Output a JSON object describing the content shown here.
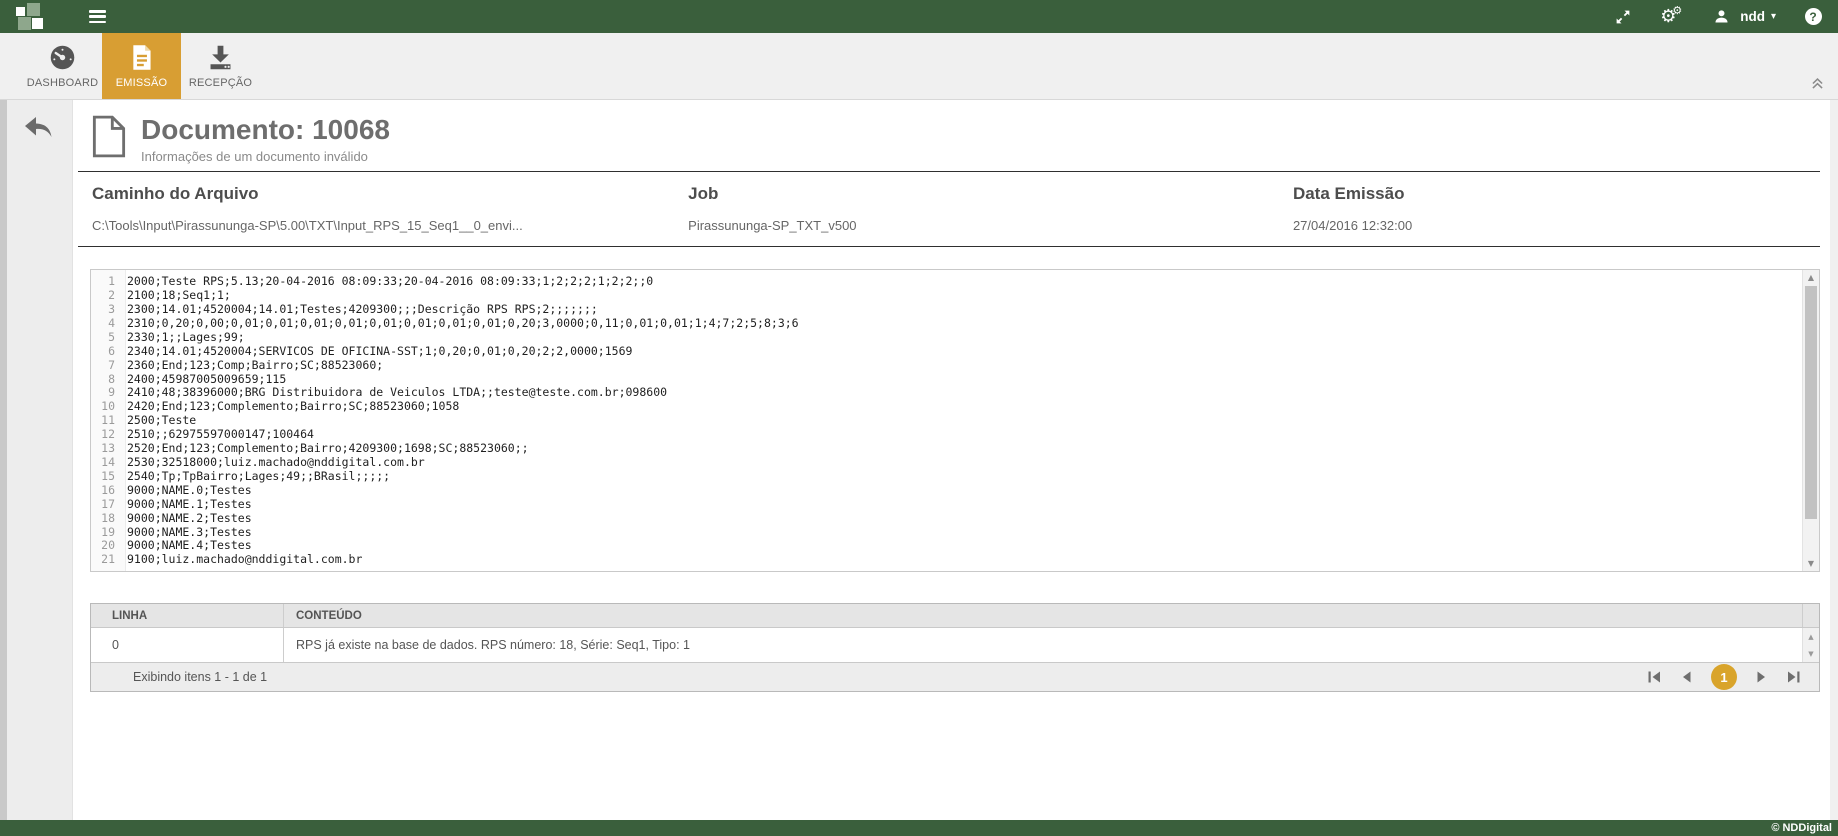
{
  "topbar": {
    "user_label": "ndd",
    "help_glyph": "?"
  },
  "nav": {
    "tabs": [
      {
        "label": "DASHBOARD",
        "active": false
      },
      {
        "label": "EMISSÃO",
        "active": true
      },
      {
        "label": "RECEPÇÃO",
        "active": false
      }
    ]
  },
  "document": {
    "title": "Documento: 10068",
    "subtitle": "Informações de um documento inválido",
    "fields": [
      {
        "label": "Caminho do Arquivo",
        "value": "C:\\Tools\\Input\\Pirassununga-SP\\5.00\\TXT\\Input_RPS_15_Seq1__0_envi..."
      },
      {
        "label": "Job",
        "value": "Pirassununga-SP_TXT_v500"
      },
      {
        "label": "Data Emissão",
        "value": "27/04/2016 12:32:00"
      }
    ]
  },
  "code": {
    "lines": [
      "2000;Teste RPS;5.13;20-04-2016 08:09:33;20-04-2016 08:09:33;1;2;2;2;1;2;2;;0",
      "2100;18;Seq1;1;",
      "2300;14.01;4520004;14.01;Testes;4209300;;;Descrição RPS RPS;2;;;;;;;",
      "2310;0,20;0,00;0,01;0,01;0,01;0,01;0,01;0,01;0,01;0,01;0,20;3,0000;0,11;0,01;0,01;1;4;7;2;5;8;3;6",
      "2330;1;;Lages;99;",
      "2340;14.01;4520004;SERVICOS DE OFICINA-SST;1;0,20;0,01;0,20;2;2,0000;1569",
      "2360;End;123;Comp;Bairro;SC;88523060;",
      "2400;45987005009659;115",
      "2410;48;38396000;BRG Distribuidora de Veiculos LTDA;;teste@teste.com.br;098600",
      "2420;End;123;Complemento;Bairro;SC;88523060;1058",
      "2500;Teste",
      "2510;;62975597000147;100464",
      "2520;End;123;Complemento;Bairro;4209300;1698;SC;88523060;;",
      "2530;32518000;luiz.machado@nddigital.com.br",
      "2540;Tp;TpBairro;Lages;49;;BRasil;;;;;",
      "9000;NAME.0;Testes",
      "9000;NAME.1;Testes",
      "9000;NAME.2;Testes",
      "9000;NAME.3;Testes",
      "9000;NAME.4;Testes",
      "9100;luiz.machado@nddigital.com.br"
    ]
  },
  "errors_table": {
    "columns": [
      "LINHA",
      "CONTEÚDO"
    ],
    "rows": [
      {
        "linha": "0",
        "conteudo": "RPS já existe na base de dados. RPS número: 18, Série: Seq1, Tipo: 1"
      }
    ],
    "summary": "Exibindo itens 1 - 1 de 1",
    "page": "1"
  },
  "footer": {
    "copyright": "© NDDigital"
  },
  "colors": {
    "brand_green": "#3a5f3c",
    "accent_orange": "#d89e33",
    "pager_orange": "#d9a42b"
  },
  "icons": {
    "gear": "⚙",
    "caret_down": "▾",
    "up_arrow": "▲",
    "down_arrow": "▼"
  }
}
